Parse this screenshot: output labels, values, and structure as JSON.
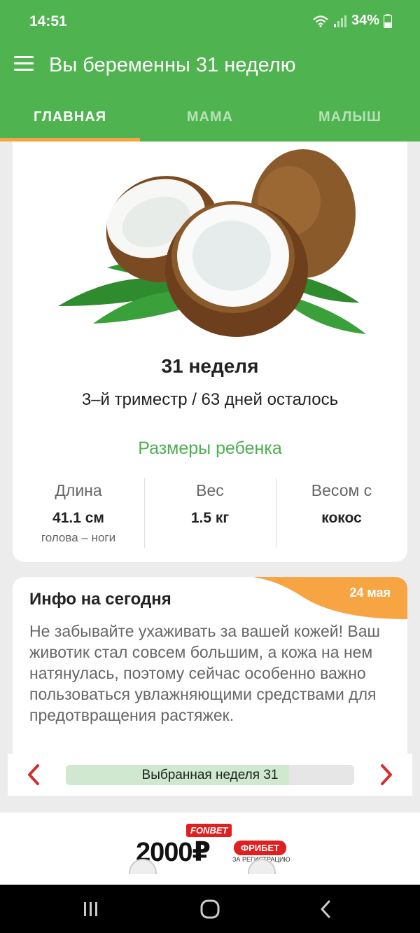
{
  "status_bar": {
    "time": "14:51",
    "battery": "34%"
  },
  "toolbar": {
    "title": "Вы беременны 31 неделю",
    "menu_icon": "hamburger-menu-icon"
  },
  "tabs": [
    {
      "label": "ГЛАВНАЯ",
      "active": true
    },
    {
      "label": "МАМА",
      "active": false
    },
    {
      "label": "МАЛЫШ",
      "active": false
    }
  ],
  "week_card": {
    "image": "coconut",
    "week_title": "31 неделя",
    "trimester_line": "3–й триместр / 63 дней осталось",
    "sizes_title": "Размеры ребенка",
    "stats": [
      {
        "label": "Длина",
        "value": "41.1 см",
        "sub": "голова – ноги"
      },
      {
        "label": "Вес",
        "value": "1.5 кг",
        "sub": ""
      },
      {
        "label": "Весом с",
        "value": "кокос",
        "sub": ""
      }
    ]
  },
  "info_card": {
    "title": "Инфо на сегодня",
    "date": "24 мая",
    "text": "Не забывайте ухаживать за вашей кожей! Ваш животик стал совсем большим, а кожа на нем натянулась, поэтому сейчас особенно важно пользоваться увлажняющими средствами для предотвращения растяжек."
  },
  "week_selector": {
    "label": "Выбранная неделя 31",
    "progress_fraction": 0.775
  },
  "ad": {
    "brand": "FONBET",
    "amount": "2000₽",
    "badge": "ФРИБЕТ",
    "sub": "ЗА РЕГИСТРАЦИЮ"
  },
  "colors": {
    "primary": "#4fb34f",
    "accent": "#f7a543",
    "green_text": "#4caf50",
    "arrow": "#d32f2f"
  }
}
